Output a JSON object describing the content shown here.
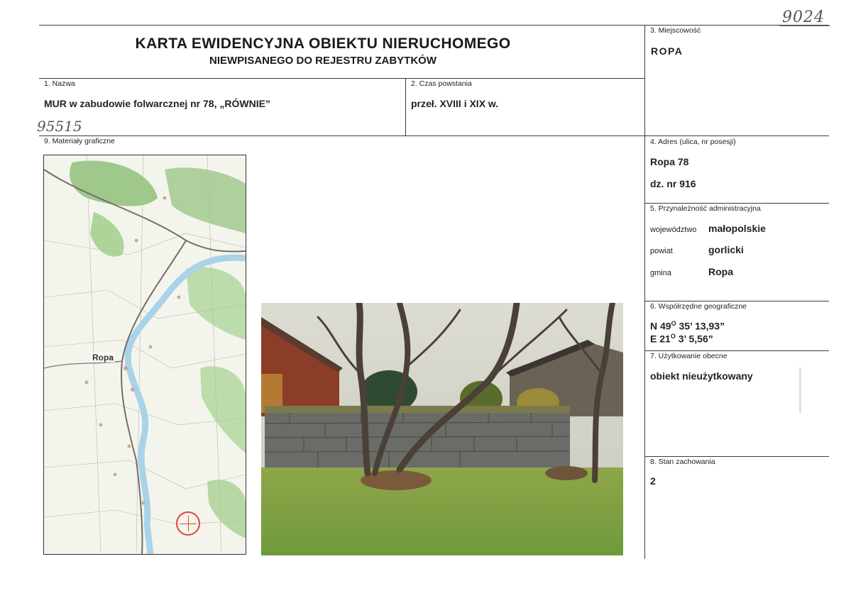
{
  "title_main": "KARTA EWIDENCYJNA OBIEKTU NIERUCHOMEGO",
  "title_sub": "NIEWPISANEGO DO REJESTRU ZABYTKÓW",
  "handwritten_top": "9024",
  "handwritten_left": "95515",
  "fields": {
    "nazwa": {
      "label": "1. Nazwa",
      "value": "MUR w zabudowie folwarcznej nr 78, „RÓWNIE”"
    },
    "czas": {
      "label": "2. Czas powstania",
      "value": "przeł. XVIII i XIX w."
    },
    "miejscowosc": {
      "label": "3. Miejscowość",
      "value": "ROPA"
    },
    "adres": {
      "label": "4. Adres (ulica, nr posesji)",
      "line1": "Ropa 78",
      "line2": "dz. nr 916"
    },
    "przynaleznosc": {
      "label": "5. Przynależność administracyjna",
      "rows": [
        {
          "key": "województwo",
          "value": "małopolskie"
        },
        {
          "key": "powiat",
          "value": "gorlicki"
        },
        {
          "key": "gmina",
          "value": "Ropa"
        }
      ]
    },
    "wspolrzedne": {
      "label": "6. Współrzędne geograficzne",
      "n_prefix": "N 49",
      "n_deg": "O",
      "n_rest": " 35’ 13,93”",
      "e_prefix": "E 21",
      "e_deg": "O",
      "e_rest": " 3’ 5,56”"
    },
    "uzytkowanie": {
      "label": "7. Użytkowanie obecne",
      "value": "obiekt nieużytkowany"
    },
    "stan": {
      "label": "8. Stan zachowania",
      "value": "2"
    },
    "materialy": {
      "label": "9. Materiały graficzne"
    }
  },
  "map": {
    "place_label": "Ropa",
    "marker_color": "#e0463a",
    "river_color": "#a9d3e8",
    "forest_color": "#8fc07a"
  },
  "photo": {
    "description_icon": "photo-wall-image"
  }
}
